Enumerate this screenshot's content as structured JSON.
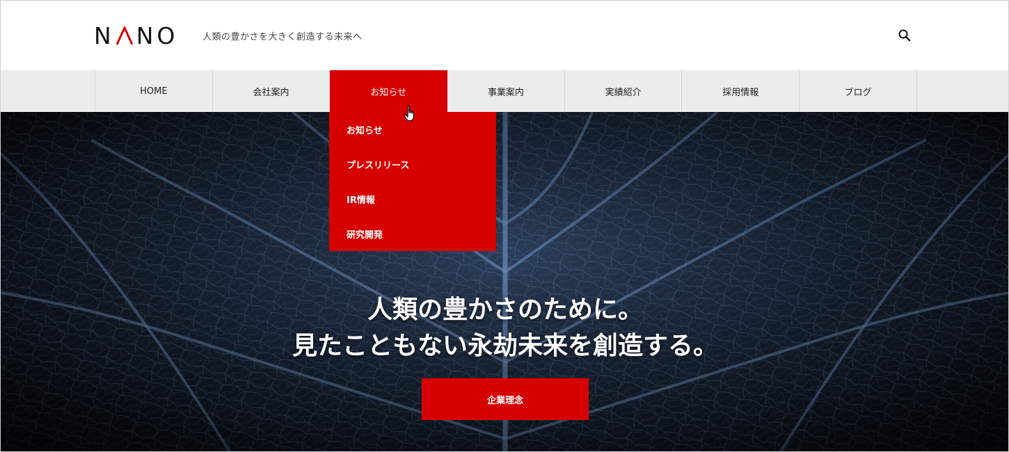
{
  "header": {
    "logo": "NANO",
    "tagline": "人類の豊かさを大きく創造する未来へ",
    "search_icon": "search-icon"
  },
  "nav": {
    "items": [
      {
        "label": "HOME"
      },
      {
        "label": "会社案内"
      },
      {
        "label": "お知らせ",
        "active": true
      },
      {
        "label": "事業案内"
      },
      {
        "label": "実績紹介"
      },
      {
        "label": "採用情報"
      },
      {
        "label": "ブログ"
      }
    ]
  },
  "dropdown": {
    "items": [
      {
        "label": "お知らせ"
      },
      {
        "label": "プレスリリース"
      },
      {
        "label": "IR情報"
      },
      {
        "label": "研究開発"
      }
    ]
  },
  "hero": {
    "line1": "人類の豊かさのために。",
    "line2": "見たこともない永劫未来を創造する。",
    "cta_label": "企業理念"
  },
  "colors": {
    "accent": "#d60000",
    "nav_bg": "#ececec",
    "hero_bg": "#1b2638"
  }
}
